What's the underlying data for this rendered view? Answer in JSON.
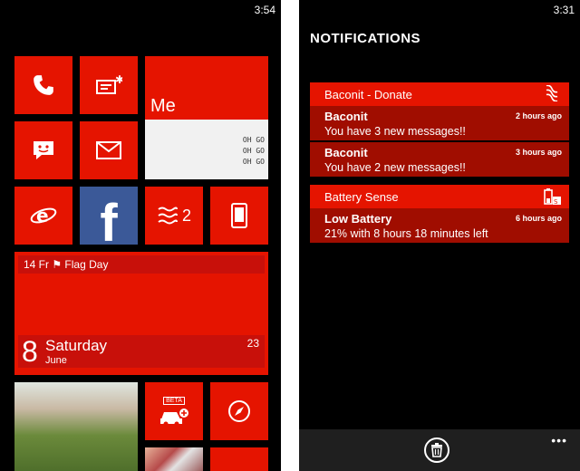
{
  "left_screen": {
    "time": "3:54",
    "tiles": {
      "phone": {
        "icon": "phone-icon"
      },
      "messaging": {
        "icon": "message-star-icon"
      },
      "me": {
        "label": "Me",
        "photo_text": [
          "OH GO",
          "OH GO",
          "OH GO"
        ]
      },
      "chat": {
        "icon": "chat-smiley-icon"
      },
      "mail": {
        "icon": "mail-icon"
      },
      "ie": {
        "icon": "internet-explorer-icon"
      },
      "facebook": {
        "icon": "facebook-icon",
        "glyph": "f"
      },
      "baconit": {
        "icon": "baconit-icon",
        "count": "2"
      },
      "phone_device": {
        "icon": "device-icon"
      },
      "calendar": {
        "event": "14 Fr  ⚑ Flag Day",
        "day_number": "8",
        "weekday": "Saturday",
        "month": "June",
        "count": "23"
      },
      "car": {
        "icon": "car-add-icon",
        "beta_label": "BETA"
      },
      "compass": {
        "icon": "compass-icon"
      }
    }
  },
  "right_screen": {
    "time": "3:31",
    "title": "NOTIFICATIONS",
    "groups": [
      {
        "name": "Baconit - Donate",
        "icon": "baconit-icon",
        "items": [
          {
            "title": "Baconit",
            "body": "You have 3 new messages!!",
            "time": "2 hours ago"
          },
          {
            "title": "Baconit",
            "body": "You have 2 new messages!!",
            "time": "3 hours ago"
          }
        ]
      },
      {
        "name": "Battery Sense",
        "icon": "battery-icon",
        "items": [
          {
            "title": "Low Battery",
            "body": "21% with 8 hours 18 minutes left",
            "time": "6 hours ago"
          }
        ]
      }
    ],
    "appbar": {
      "delete_icon": "trash-icon",
      "more": "•••"
    }
  },
  "colors": {
    "accent": "#e51400",
    "accent_dark": "#a00d00",
    "facebook": "#3b5998",
    "background": "#000000",
    "appbar": "#1f1f1f"
  }
}
